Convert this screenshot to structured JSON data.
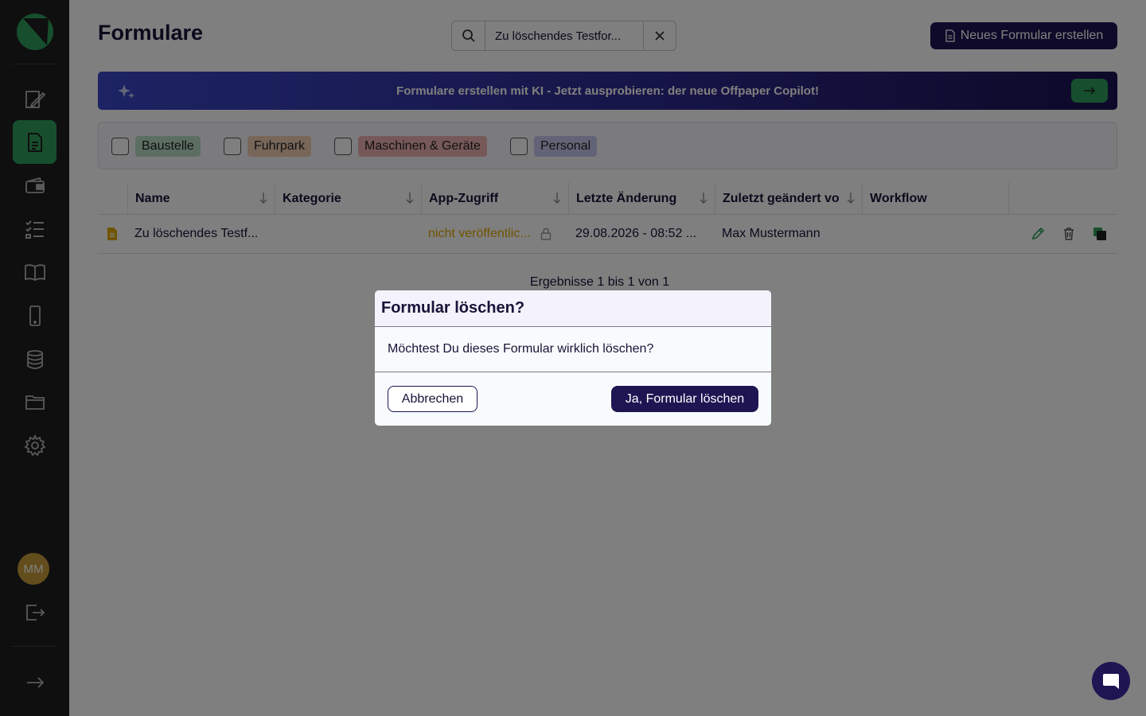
{
  "header": {
    "title": "Formulare",
    "search_value": "Zu löschendes Testfor...",
    "new_button_label": "Neues Formular erstellen"
  },
  "banner": {
    "text": "Formulare erstellen mit KI - Jetzt ausprobieren: der neue Offpaper Copilot!"
  },
  "filters": [
    {
      "label": "Baustelle",
      "color": "#b9dcc5"
    },
    {
      "label": "Fuhrpark",
      "color": "#f0cdb2"
    },
    {
      "label": "Maschinen & Geräte",
      "color": "#eeb0b0"
    },
    {
      "label": "Personal",
      "color": "#c4c6ec"
    }
  ],
  "table": {
    "columns": [
      "Name",
      "Kategorie",
      "App-Zugriff",
      "Letzte Änderung",
      "Zuletzt geändert vo",
      "Workflow"
    ],
    "rows": [
      {
        "name": "Zu löschendes Testf...",
        "category": "",
        "access": "nicht veröffentlic...",
        "modified": "29.08.2026 - 08:52 ...",
        "modified_by": "Max Mustermann",
        "workflow": ""
      }
    ]
  },
  "results_text": "Ergebnisse 1 bis 1 von 1",
  "sidebar": {
    "avatar_initials": "MM",
    "items": [
      "editor-icon",
      "forms-icon",
      "wallet-icon",
      "checklist-icon",
      "book-icon",
      "mobile-icon",
      "database-icon",
      "folder-icon",
      "settings-icon"
    ]
  },
  "dialog": {
    "title": "Formular löschen?",
    "message": "Möchtest Du dieses Formular wirklich löschen?",
    "cancel_label": "Abbrechen",
    "confirm_label": "Ja, Formular löschen"
  },
  "colors": {
    "brand_dark": "#1e1552",
    "brand_green": "#2e9e5c",
    "sidebar_bg": "#1f1f1f",
    "access_warning": "#e0a800"
  }
}
